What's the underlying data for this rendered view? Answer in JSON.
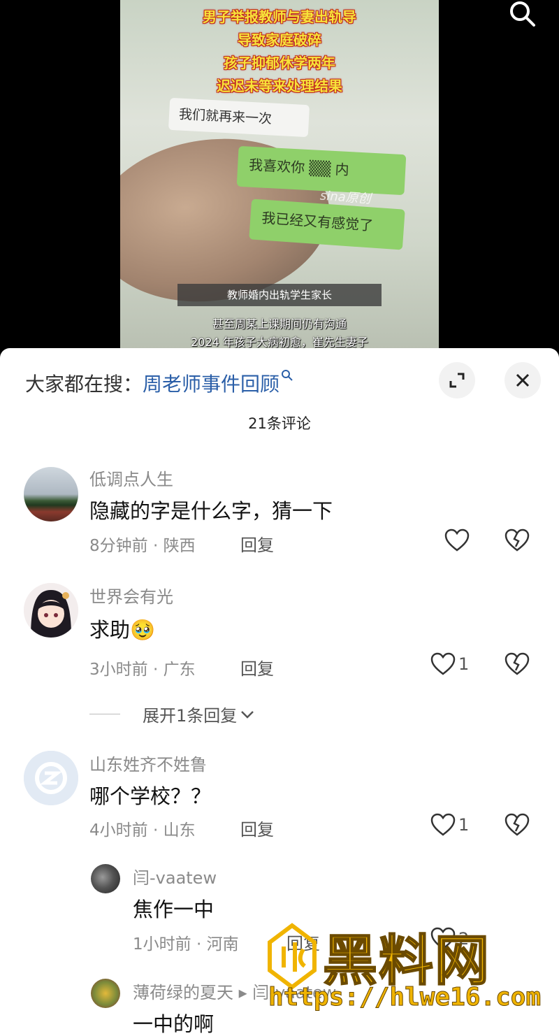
{
  "video": {
    "headline_lines": [
      "男子举报教师与妻出轨导",
      "导致家庭破碎",
      "孩子抑郁休学两年",
      "迟迟未等来处理结果"
    ],
    "chat_white": "我们就再来一次",
    "chat_green_1": "我喜欢你 ▒▒ 内",
    "chat_green_2": "我已经又有感觉了",
    "sina_watermark": "sina原创",
    "caption_box": "教师婚内出轨学生家长",
    "subtitle_1": "甚至周某上课期间仍有沟通",
    "subtitle_2": "2024 年孩子大病初愈，崔先生妻子"
  },
  "sheet": {
    "search_prefix": "大家都在搜：",
    "search_link": "周老师事件回顾",
    "comment_count": "21条评论",
    "comments": [
      {
        "name": "低调点人生",
        "text": "隐藏的字是什么字，猜一下",
        "meta": "8分钟前 · 陕西",
        "reply": "回复",
        "likes": ""
      },
      {
        "name": "世界会有光",
        "text": "求助🥹",
        "meta": "3小时前 · 广东",
        "reply": "回复",
        "likes": "1",
        "expand": "展开1条回复"
      },
      {
        "name": "山东姓齐不姓鲁",
        "text": "哪个学校？？",
        "meta": "4小时前 · 山东",
        "reply": "回复",
        "likes": "1"
      }
    ],
    "replies": [
      {
        "name": "闫-vaatew",
        "text": "焦作一中",
        "meta": "1小时前 · 河南",
        "reply": "回复",
        "likes": "2"
      },
      {
        "name": "薄荷绿的夏天 ▸ 闫-vaatew",
        "text": "一中的啊"
      }
    ]
  },
  "watermark": {
    "title": "黑料网",
    "url": "https://hlwe16.com"
  },
  "colors": {
    "link": "#2b5fa8",
    "headline": "#f7e23a",
    "chat_green": "#8fd06a",
    "wm_gold": "#f0b400"
  }
}
